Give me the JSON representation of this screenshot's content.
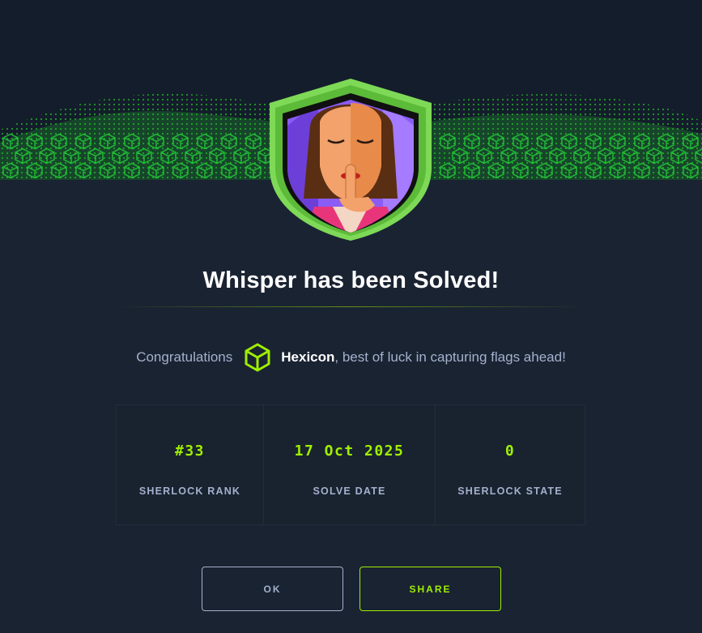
{
  "modal": {
    "title": "Whisper has been Solved!",
    "congrats_prefix": "Congratulations",
    "username": "Hexicon",
    "congrats_suffix": ", best of luck in capturing flags ahead!",
    "badge_icon": "whisper-badge",
    "user_icon": "hexagon-cube-icon"
  },
  "stats": [
    {
      "value": "#33",
      "label": "SHERLOCK RANK"
    },
    {
      "value": "17 Oct 2025",
      "label": "SOLVE DATE"
    },
    {
      "value": "0",
      "label": "SHERLOCK STATE"
    }
  ],
  "buttons": {
    "ok": "OK",
    "share": "SHARE"
  },
  "colors": {
    "background": "#1a2332",
    "accent": "#9fef00",
    "muted": "#a4b1cd",
    "banner_green": "#2aff2a"
  }
}
